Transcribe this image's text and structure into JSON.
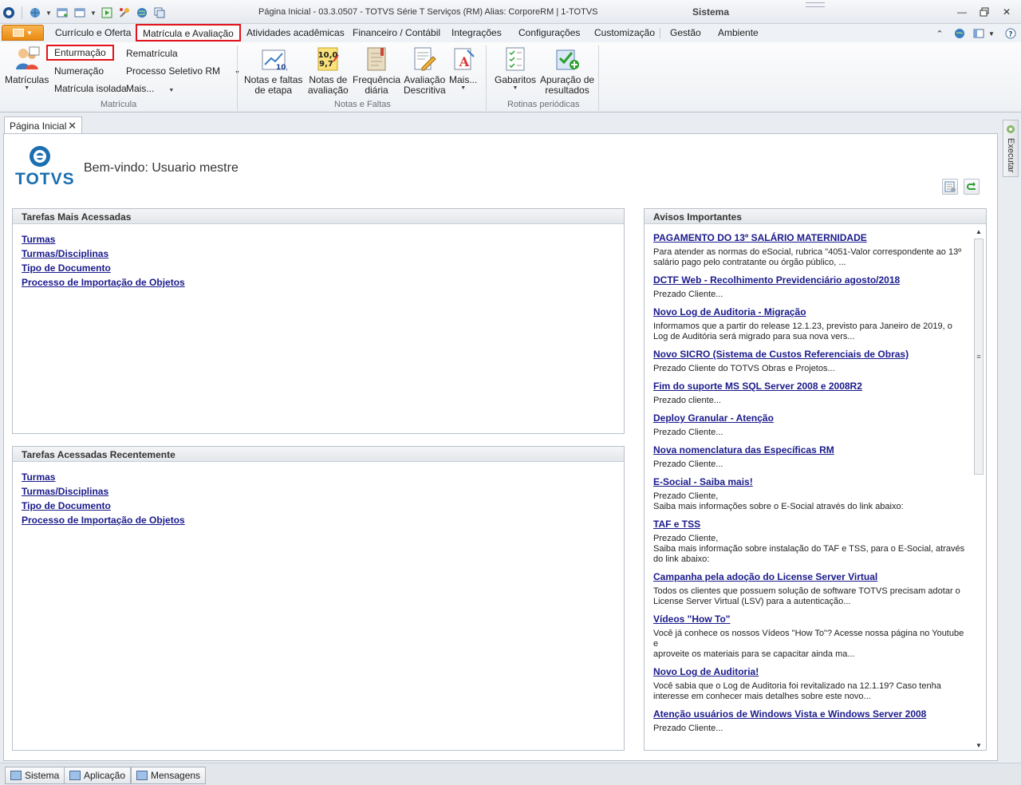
{
  "window": {
    "title": "Página Inicial - 03.3.0507 - TOTVS Série T Serviços (RM) Alias: CorporeRM | 1-TOTVS",
    "section": "Sistema"
  },
  "ribbon_tabs": [
    {
      "label": "Currículo e Oferta"
    },
    {
      "label": "Matrícula e Avaliação"
    },
    {
      "label": "Atividades acadêmicas"
    },
    {
      "label": "Financeiro / Contábil"
    },
    {
      "label": "Integrações"
    },
    {
      "label": "Configurações"
    },
    {
      "label": "Customização"
    },
    {
      "label": "Gestão"
    },
    {
      "label": "Ambiente"
    }
  ],
  "ribbon": {
    "matricula": {
      "big_label": "Matrículas",
      "enturmacao": "Enturmação",
      "numeracao": "Numeração",
      "matricula_isolada": "Matrícula isolada",
      "rematricula": "Rematrícula",
      "processo_seletivo": "Processo Seletivo RM",
      "mais": "Mais...",
      "group_label": "Matrícula"
    },
    "notas": {
      "notas_faltas_l1": "Notas e faltas",
      "notas_faltas_l2": "de etapa",
      "notas_aval_l1": "Notas de",
      "notas_aval_l2": "avaliação",
      "freq_l1": "Frequência",
      "freq_l2": "diária",
      "aval_desc_l1": "Avaliação",
      "aval_desc_l2": "Descritiva",
      "mais": "Mais...",
      "group_label": "Notas e Faltas"
    },
    "rotinas": {
      "gabaritos": "Gabaritos",
      "apuracao_l1": "Apuração de",
      "apuracao_l2": "resultados",
      "group_label": "Rotinas periódicas"
    }
  },
  "doc_tab": {
    "label": "Página Inicial"
  },
  "side_panel": {
    "label": "Executar"
  },
  "home": {
    "logo_text": "TOTVS",
    "welcome": "Bem-vindo: Usuario mestre"
  },
  "tarefas_mais": {
    "title": "Tarefas Mais Acessadas",
    "links": [
      "Turmas",
      "Turmas/Disciplinas",
      "Tipo de Documento",
      "Processo de Importação de Objetos"
    ]
  },
  "tarefas_recentes": {
    "title": "Tarefas Acessadas Recentemente",
    "links": [
      "Turmas",
      "Turmas/Disciplinas",
      "Tipo de Documento",
      "Processo de Importação de Objetos"
    ]
  },
  "avisos": {
    "title": "Avisos Importantes",
    "items": [
      {
        "title": "PAGAMENTO DO 13º SALÁRIO MATERNIDADE",
        "body": "Para atender as normas do eSocial, rubrica \"4051-Valor correspondente ao 13º\nsalário pago pelo contratante ou órgão público, ..."
      },
      {
        "title": "DCTF Web - Recolhimento Previdenciário agosto/2018",
        "body": "Prezado Cliente..."
      },
      {
        "title": "Novo Log de Auditoria - Migração",
        "body": "Informamos que a partir do release 12.1.23, previsto para Janeiro de 2019, o\nLog de Auditória será migrado para sua nova vers..."
      },
      {
        "title": "Novo SICRO (Sistema de Custos Referenciais de Obras)",
        "body": "Prezado Cliente do TOTVS Obras e Projetos..."
      },
      {
        "title": "Fim do suporte MS SQL Server 2008 e 2008R2",
        "body": "Prezado cliente..."
      },
      {
        "title": "Deploy Granular - Atenção",
        "body": "Prezado Cliente..."
      },
      {
        "title": "Nova nomenclatura das Específicas RM",
        "body": "Prezado Cliente..."
      },
      {
        "title": "E-Social - Saiba mais!",
        "body": "Prezado Cliente,\nSaiba mais informações sobre o E-Social através do link abaixo:"
      },
      {
        "title": "TAF e TSS",
        "body": "Prezado Cliente,\nSaiba mais informação sobre instalação do TAF e TSS, para o E-Social, através\ndo link abaixo:"
      },
      {
        "title": "Campanha pela adoção do License Server Virtual",
        "body": "Todos os clientes que possuem solução de software TOTVS precisam adotar o\nLicense  Server  Virtual (LSV) para a autenticação..."
      },
      {
        "title": "Vídeos \"How To\"",
        "body": "Você já conhece os nossos Vídeos \"How To\"? Acesse nossa página no Youtube e\naproveite os materiais para se capacitar ainda ma..."
      },
      {
        "title": "Novo Log de Auditoria!",
        "body": "Você sabia que o Log de Auditoria foi revitalizado na 12.1.19? Caso tenha\ninteresse em conhecer mais detalhes sobre este novo..."
      },
      {
        "title": "Atenção usuários de Windows Vista e Windows Server 2008",
        "body": "Prezado Cliente..."
      }
    ]
  },
  "statusbar": {
    "sistema": "Sistema",
    "aplicacao": "Aplicação",
    "mensagens": "Mensagens"
  },
  "colors": {
    "highlight_border": "#e2131a",
    "link": "#1a1a8c",
    "brand_blue": "#1a6fb0",
    "file_button": "#e98a12"
  }
}
